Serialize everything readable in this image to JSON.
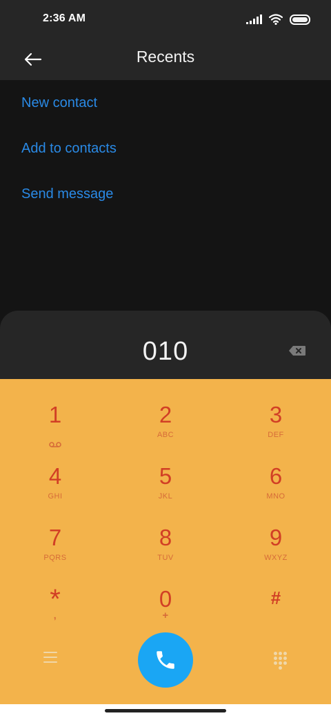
{
  "status_bar": {
    "time": "2:36 AM"
  },
  "app_bar": {
    "title": "Recents"
  },
  "actions": [
    {
      "label": "New contact"
    },
    {
      "label": "Add to contacts"
    },
    {
      "label": "Send message"
    }
  ],
  "dialer": {
    "number": "010"
  },
  "keypad": {
    "keys": [
      {
        "digit": "1",
        "letters": ""
      },
      {
        "digit": "2",
        "letters": "ABC"
      },
      {
        "digit": "3",
        "letters": "DEF"
      },
      {
        "digit": "4",
        "letters": "GHI"
      },
      {
        "digit": "5",
        "letters": "JKL"
      },
      {
        "digit": "6",
        "letters": "MNO"
      },
      {
        "digit": "7",
        "letters": "PQRS"
      },
      {
        "digit": "8",
        "letters": "TUV"
      },
      {
        "digit": "9",
        "letters": "WXYZ"
      },
      {
        "digit": "*",
        "letters": ","
      },
      {
        "digit": "0",
        "letters": "+"
      },
      {
        "digit": "#",
        "letters": ""
      }
    ]
  },
  "colors": {
    "accent_link": "#2a8ae6",
    "keypad_bg": "#f3b34b",
    "key_text": "#d13f25",
    "call_button": "#1aa6f4"
  },
  "icons": {
    "back": "arrow-left-icon",
    "backspace": "backspace-icon",
    "voicemail": "voicemail-icon",
    "menu": "menu-icon",
    "call": "phone-icon",
    "dialpad": "dialpad-icon"
  }
}
